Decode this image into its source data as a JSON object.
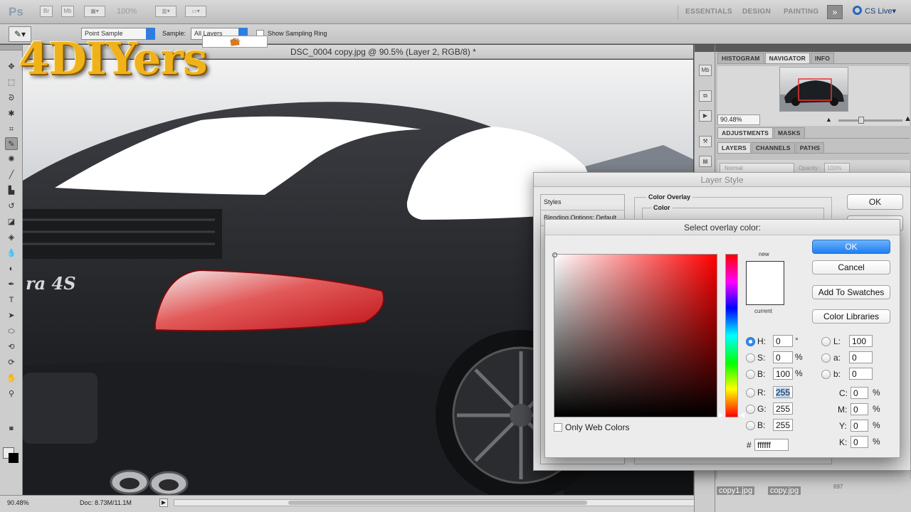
{
  "app": {
    "logo_short": "Ps",
    "zoom_display": "100%",
    "workspaces": [
      "ESSENTIALS",
      "DESIGN",
      "PAINTING"
    ],
    "more_symbol": "»",
    "cs_live": "CS Live"
  },
  "options_bar": {
    "size_value": "Point Sample",
    "sample_label": "Sample:",
    "sample_value": "All Layers",
    "show_ring_label": "Show Sampling Ring"
  },
  "document": {
    "tab_title": "DSC_0004 copy.jpg @ 90.5% (Layer 2, RGB/8) *",
    "badge_text": "ra 4S"
  },
  "status_bar": {
    "zoom": "90.48%",
    "doc_info": "Doc: 8.73M/11.1M"
  },
  "logo": {
    "text": "4DIYers"
  },
  "panels": {
    "top_tabs": [
      "HISTOGRAM",
      "NAVIGATOR",
      "INFO"
    ],
    "navigator_zoom": "90.48%",
    "mid_tabs": [
      "ADJUSTMENTS",
      "MASKS"
    ],
    "layer_tabs": [
      "LAYERS",
      "CHANNELS",
      "PATHS"
    ],
    "blend_mode": "Normal",
    "opacity_label": "Opacity:",
    "opacity_value": "100%",
    "footer_a": "copy1.jpg",
    "footer_b": "copy.jpg",
    "footer_c": "697"
  },
  "layer_style": {
    "title": "Layer Style",
    "list": [
      "Styles",
      "Blending Options: Default"
    ],
    "section_title": "Color Overlay",
    "subsection": "Color",
    "ok_label": "OK"
  },
  "color_picker": {
    "title": "Select overlay color:",
    "new_label": "new",
    "current_label": "current",
    "ok": "OK",
    "cancel": "Cancel",
    "add_to_swatches": "Add To Swatches",
    "color_libraries": "Color Libraries",
    "hsb": {
      "h": "0",
      "s": "0",
      "b": "100",
      "h_unit": "°",
      "s_unit": "%",
      "b_unit": "%"
    },
    "rgb": {
      "r": "255",
      "g": "255",
      "b": "255"
    },
    "lab": {
      "l": "100",
      "a": "0",
      "b": "0"
    },
    "cmyk": {
      "c": "0",
      "m": "0",
      "y": "0",
      "k": "0",
      "unit": "%"
    },
    "hex_prefix": "#",
    "hex": "ffffff",
    "only_web_colors": "Only Web Colors",
    "labels": {
      "H": "H:",
      "S": "S:",
      "B": "B:",
      "R": "R:",
      "G": "G:",
      "Bb": "B:",
      "L": "L:",
      "a": "a:",
      "b": "b:",
      "C": "C:",
      "M": "M:",
      "Y": "Y:",
      "K": "K:"
    }
  }
}
